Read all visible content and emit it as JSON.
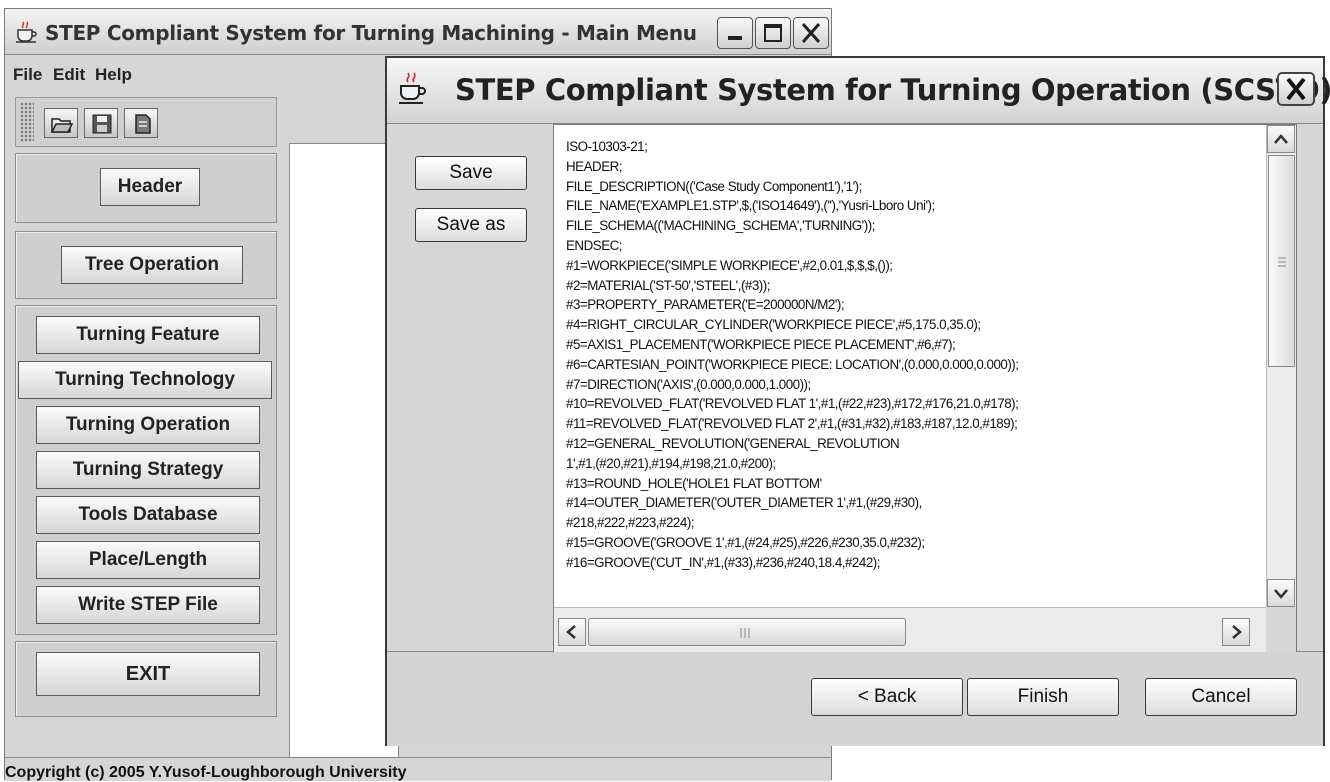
{
  "main_window": {
    "title": "STEP Compliant System for Turning Machining - Main Menu",
    "menu": [
      "File",
      "Edit",
      "Help"
    ],
    "toolbar_icons": [
      "open-folder-icon",
      "save-disk-icon",
      "document-icon"
    ],
    "buttons": {
      "header": "Header",
      "tree_operation": "Tree Operation",
      "turning_feature": "Turning Feature",
      "turning_technology": "Turning Technology",
      "turning_operation": "Turning Operation",
      "turning_strategy": "Turning Strategy",
      "tools_database": "Tools Database",
      "place_length": "Place/Length",
      "write_step_file": "Write STEP File",
      "exit": "EXIT"
    },
    "status": "Copyright (c) 2005 Y.Yusof-Loughborough University"
  },
  "dialog": {
    "title": "STEP Compliant System for Turning Operation (SCSTO)",
    "save_label": "Save",
    "save_as_label": "Save as",
    "back_label": "< Back",
    "finish_label": "Finish",
    "cancel_label": "Cancel",
    "step_text": "ISO-10303-21;\nHEADER;\nFILE_DESCRIPTION(('Case Study Component1'),'1');\nFILE_NAME('EXAMPLE1.STP',$,('ISO14649'),(''),'Yusri-Lboro Uni');\nFILE_SCHEMA(('MACHINING_SCHEMA','TURNING'));\nENDSEC;\n#1=WORKPIECE('SIMPLE WORKPIECE',#2,0.01,$,$,$,());\n#2=MATERIAL('ST-50','STEEL',(#3));\n#3=PROPERTY_PARAMETER('E=200000N/M2');\n#4=RIGHT_CIRCULAR_CYLINDER('WORKPIECE PIECE',#5,175.0,35.0);\n#5=AXIS1_PLACEMENT('WORKPIECE PIECE PLACEMENT',#6,#7);\n#6=CARTESIAN_POINT('WORKPIECE PIECE: LOCATION',(0.000,0.000,0.000));\n#7=DIRECTION('AXIS',(0.000,0.000,1.000));\n#10=REVOLVED_FLAT('REVOLVED FLAT 1',#1,(#22,#23),#172,#176,21.0,#178);\n#11=REVOLVED_FLAT('REVOLVED FLAT 2',#1,(#31,#32),#183,#187,12.0,#189);\n#12=GENERAL_REVOLUTION('GENERAL_REVOLUTION\n1',#1,(#20,#21),#194,#198,21.0,#200);\n#13=ROUND_HOLE('HOLE1 FLAT BOTTOM'\n#14=OUTER_DIAMETER('OUTER_DIAMETER 1',#1,(#29,#30),\n#218,#222,#223,#224);\n#15=GROOVE('GROOVE 1',#1,(#24,#25),#226,#230,35.0,#232);\n#16=GROOVE('CUT_IN',#1,(#33),#236,#240,18.4,#242);",
    "icons": [
      "java-cup-icon",
      "close-icon"
    ]
  }
}
